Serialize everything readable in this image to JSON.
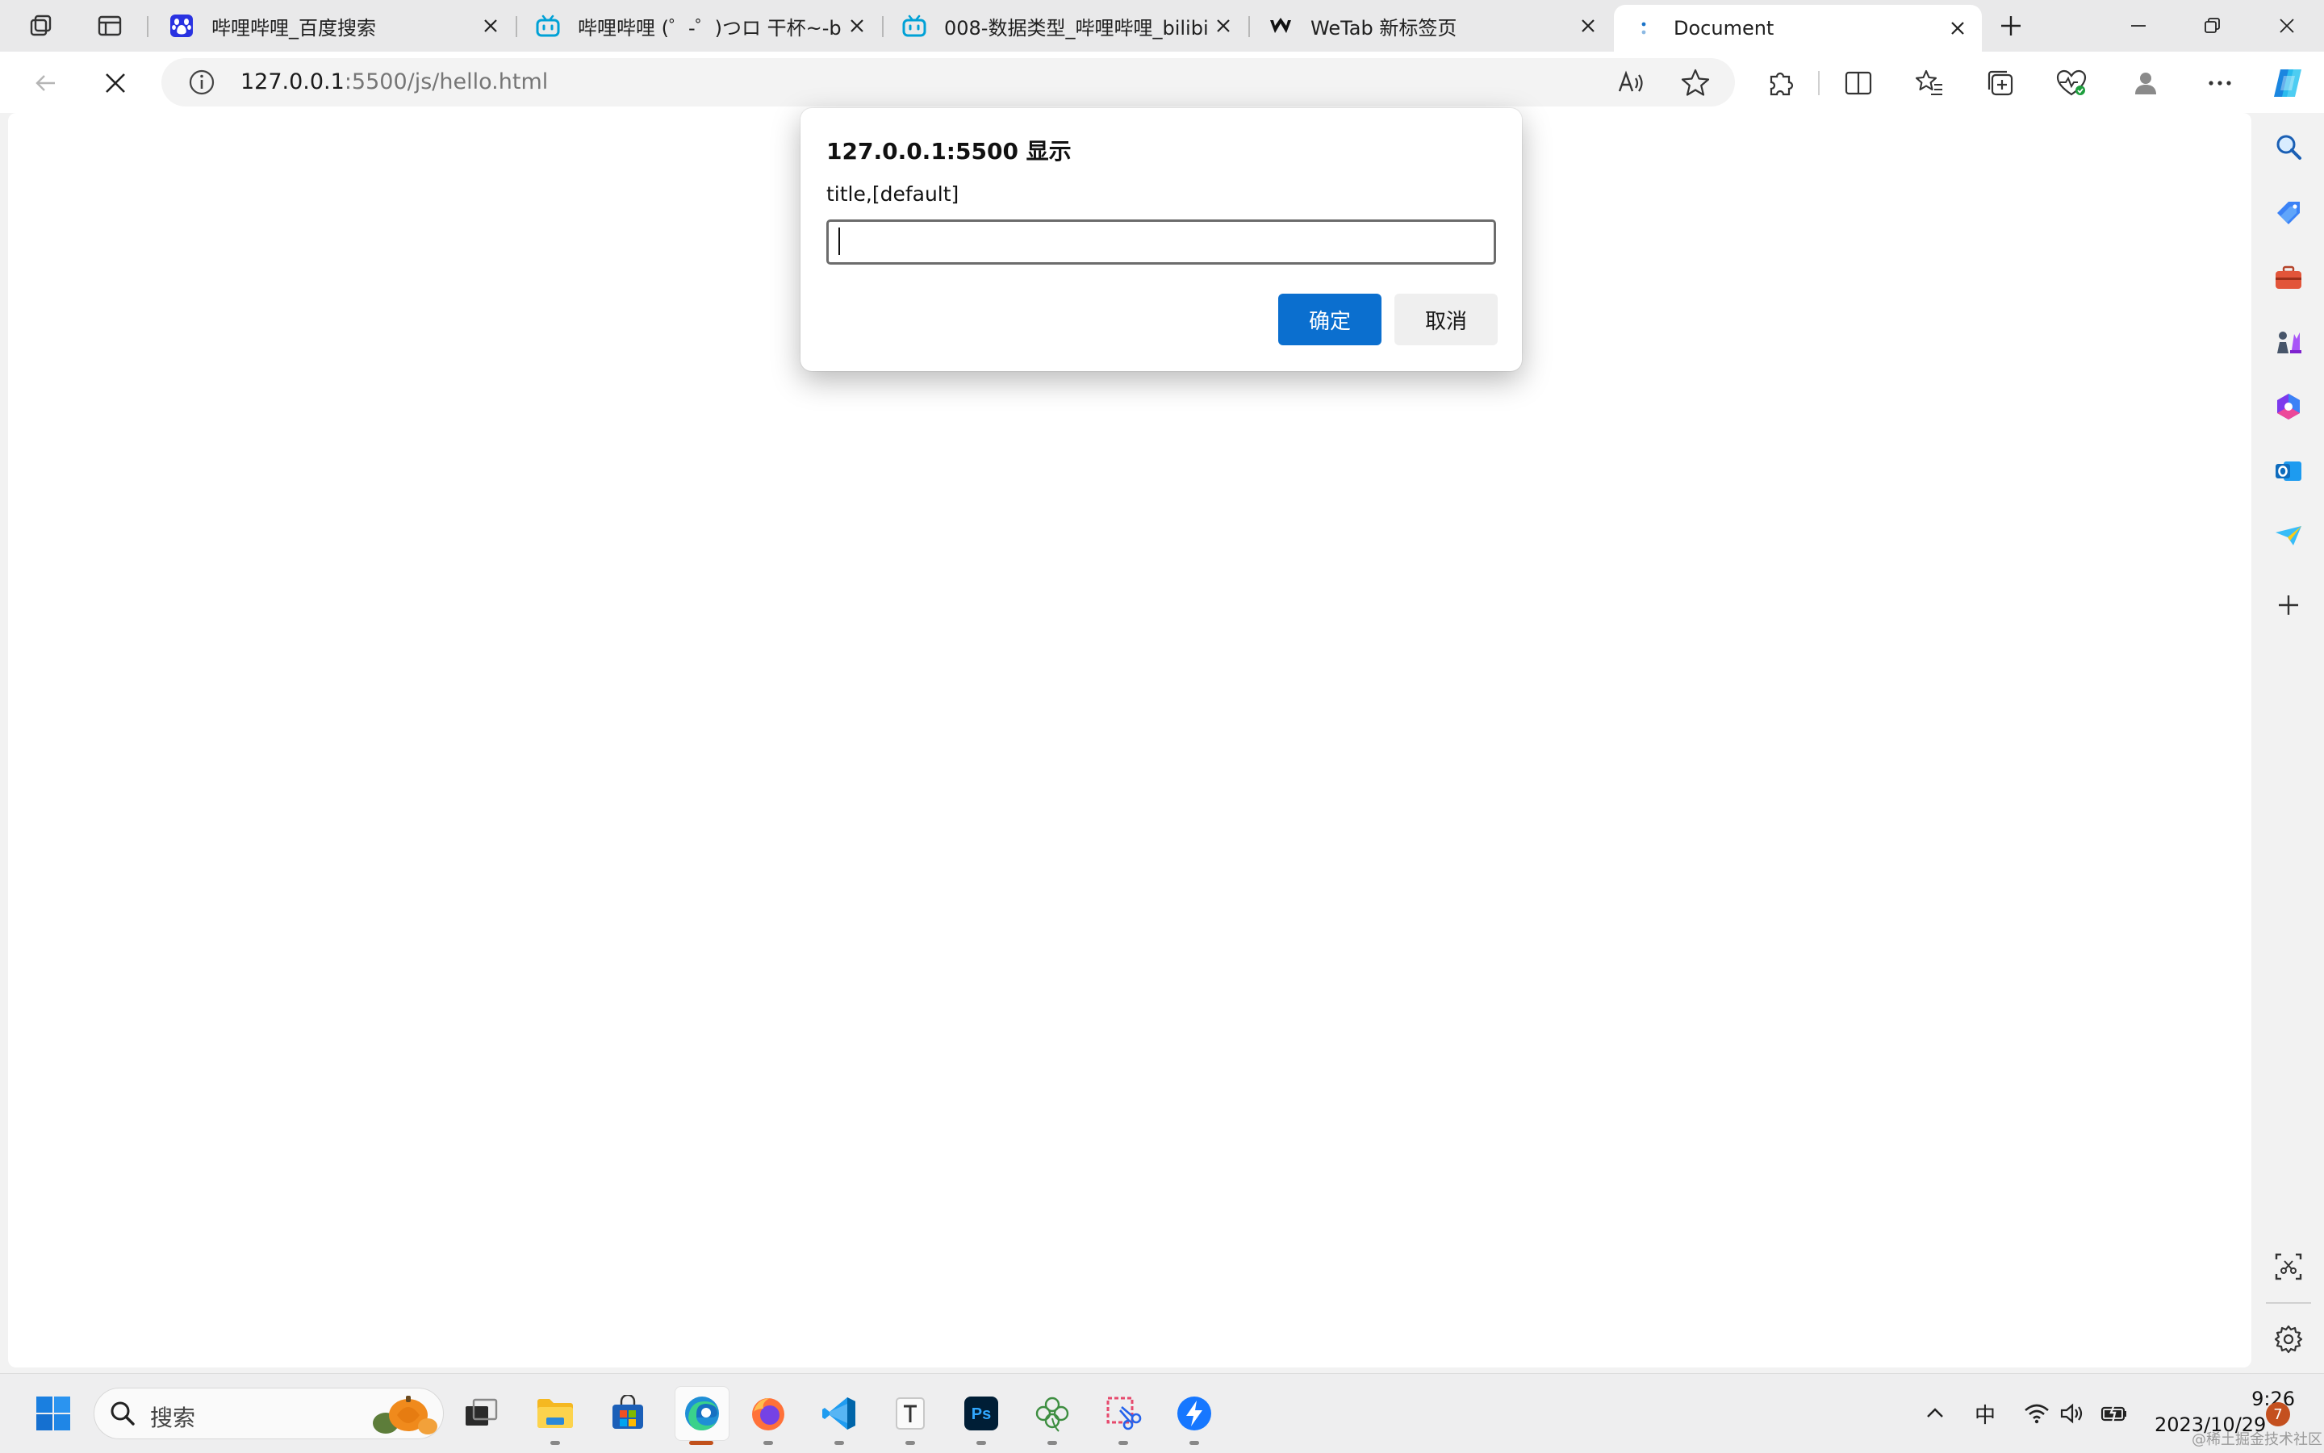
{
  "tabs": [
    {
      "title": "哔哩哔哩_百度搜索",
      "favicon": "baidu-paw-icon",
      "active": false
    },
    {
      "title": "哔哩哔哩 (゜-゜)つロ 干杯~-bi",
      "favicon": "bilibili-tv-icon",
      "active": false
    },
    {
      "title": "008-数据类型_哔哩哔哩_bilibili",
      "favicon": "bilibili-tv-icon",
      "active": false
    },
    {
      "title": "WeTab 新标签页",
      "favicon": "wetab-icon",
      "active": false
    },
    {
      "title": "Document",
      "favicon": "loading-icon",
      "active": true
    }
  ],
  "address_bar": {
    "url_host": "127.0.0.1",
    "url_rest": ":5500/js/hello.html"
  },
  "dialog": {
    "title": "127.0.0.1:5500 显示",
    "message": "title,[default]",
    "input_value": "",
    "ok_label": "确定",
    "cancel_label": "取消"
  },
  "taskbar": {
    "search_placeholder": "搜索",
    "ime_indicator": "中",
    "time": "9:26",
    "date": "2023/10/29",
    "notification_count": "7",
    "watermark": "@稀土掘金技术社区"
  },
  "colors": {
    "accent": "#0b6fcf",
    "copilot": "#1a86e0"
  }
}
